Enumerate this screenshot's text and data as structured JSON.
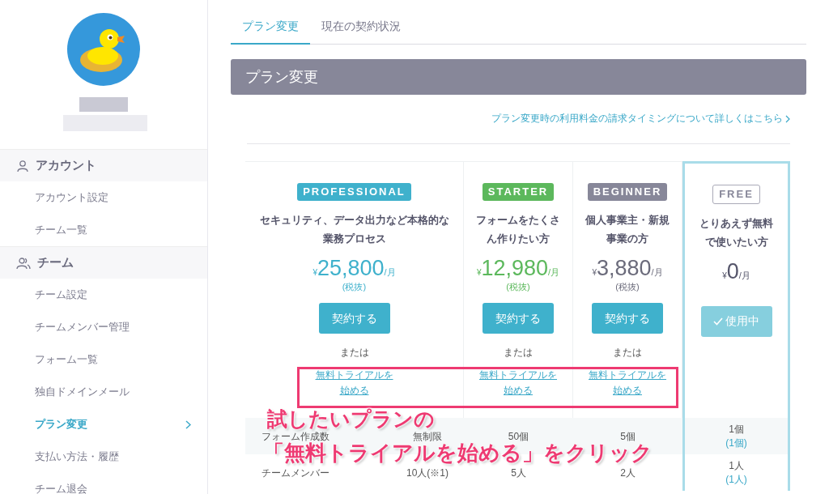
{
  "sidebar": {
    "sections": [
      {
        "title": "アカウント",
        "items": [
          {
            "label": "アカウント設定",
            "selected": false
          },
          {
            "label": "チーム一覧",
            "selected": false
          }
        ]
      },
      {
        "title": "チーム",
        "items": [
          {
            "label": "チーム設定",
            "selected": false
          },
          {
            "label": "チームメンバー管理",
            "selected": false
          },
          {
            "label": "フォーム一覧",
            "selected": false
          },
          {
            "label": "独自ドメインメール",
            "selected": false
          },
          {
            "label": "プラン変更",
            "selected": true
          },
          {
            "label": "支払い方法・履歴",
            "selected": false
          },
          {
            "label": "チーム退会",
            "selected": false
          }
        ]
      }
    ]
  },
  "tabs": [
    {
      "label": "プラン変更",
      "selected": true
    },
    {
      "label": "現在の契約状況",
      "selected": false
    }
  ],
  "header": "プラン変更",
  "info_link": "プラン変更時の利用料金の請求タイミングについて詳しくはこちら",
  "plans": [
    {
      "badge": "PROFESSIONAL",
      "kind": "professional",
      "description": "セキュリティ、データ出力など本格的な業務プロセス",
      "currency": "¥",
      "price": "25,800",
      "unit": "/月",
      "tax": "(税抜)",
      "button": "契約する",
      "current": false,
      "or_text": "または",
      "trial_link": "無料トライアルを始める"
    },
    {
      "badge": "STARTER",
      "kind": "starter",
      "description": "フォームをたくさん作りたい方",
      "currency": "¥",
      "price": "12,980",
      "unit": "/月",
      "tax": "(税抜)",
      "button": "契約する",
      "current": false,
      "or_text": "または",
      "trial_link": "無料トライアルを始める"
    },
    {
      "badge": "BEGINNER",
      "kind": "beginner",
      "description": "個人事業主・新規事業の方",
      "currency": "¥",
      "price": "3,880",
      "unit": "/月",
      "tax": "(税抜)",
      "button": "契約する",
      "current": false,
      "or_text": "または",
      "trial_link": "無料トライアルを始める"
    },
    {
      "badge": "FREE",
      "kind": "free",
      "description": "とりあえず無料で使いたい方",
      "currency": "¥",
      "price": "0",
      "unit": "/月",
      "button": "使用中",
      "current": true
    }
  ],
  "features": [
    {
      "label": "フォーム作成数",
      "values": [
        {
          "main": "無制限"
        },
        {
          "main": "50個"
        },
        {
          "main": "5個"
        },
        {
          "main": "1個",
          "sub": "(1個)"
        }
      ]
    },
    {
      "label": "チームメンバー",
      "values": [
        {
          "main": "10人(※1)"
        },
        {
          "main": "5人"
        },
        {
          "main": "2人"
        },
        {
          "main": "1人",
          "sub": "(1人)"
        }
      ]
    }
  ],
  "annotation": {
    "lines": [
      "試したいプランの",
      "「無料トライアルを始める」をクリック"
    ]
  }
}
